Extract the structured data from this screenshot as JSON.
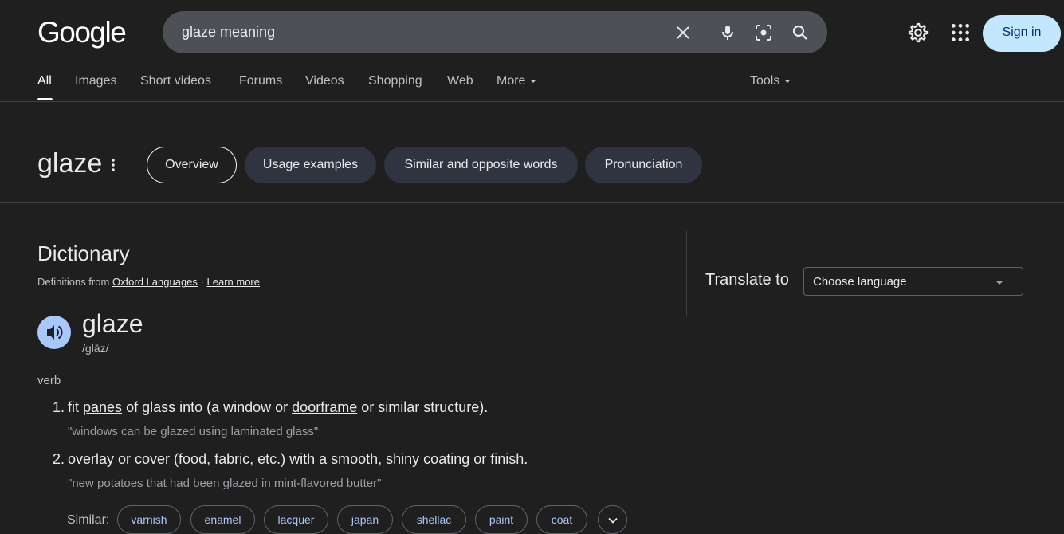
{
  "brand": {
    "logo_text": "Google"
  },
  "search": {
    "query": "glaze meaning"
  },
  "header": {
    "sign_in_label": "Sign in"
  },
  "tabs": {
    "items": [
      {
        "label": "All",
        "active": true
      },
      {
        "label": "Images"
      },
      {
        "label": "Short videos"
      },
      {
        "label": "Forums"
      },
      {
        "label": "Videos"
      },
      {
        "label": "Shopping"
      },
      {
        "label": "Web"
      },
      {
        "label": "More"
      }
    ],
    "tools_label": "Tools"
  },
  "word_bar": {
    "word": "glaze",
    "chips": [
      {
        "label": "Overview",
        "selected": true
      },
      {
        "label": "Usage examples"
      },
      {
        "label": "Similar and opposite words"
      },
      {
        "label": "Pronunciation"
      }
    ]
  },
  "dictionary": {
    "title": "Dictionary",
    "source_prefix": "Definitions from",
    "source_link": "Oxford Languages",
    "separator": "·",
    "learn_more": "Learn more",
    "headword": "glaze",
    "phonetic": "/glāz/",
    "part_of_speech": "verb",
    "definitions": [
      {
        "number": "1.",
        "parts": [
          "fit ",
          "panes",
          " of glass into (a window or ",
          "doorframe",
          " or similar structure)."
        ],
        "example": "\"windows can be glazed using laminated glass\""
      },
      {
        "number": "2.",
        "text": "overlay or cover (food, fabric, etc.) with a smooth, shiny coating or finish.",
        "example": "\"new potatoes that had been glazed in mint-flavored butter\""
      }
    ],
    "similar_label": "Similar:",
    "similar": [
      "varnish",
      "enamel",
      "lacquer",
      "japan",
      "shellac",
      "paint",
      "coat"
    ]
  },
  "translate": {
    "label": "Translate to",
    "select_value": "Choose language"
  },
  "colors": {
    "background": "#1f1f1f",
    "search_bg": "#4d5156",
    "sign_in_bg": "#c2e7ff",
    "speaker_bg": "#a8c7fa",
    "chip_bg": "#303440",
    "synonym_text": "#a8c7fa"
  },
  "icons": [
    "clear-icon",
    "mic-icon",
    "lens-icon",
    "search-icon",
    "settings-gear-icon",
    "apps-grid-icon",
    "more-vert-icon",
    "speaker-icon",
    "chevron-down-icon"
  ]
}
